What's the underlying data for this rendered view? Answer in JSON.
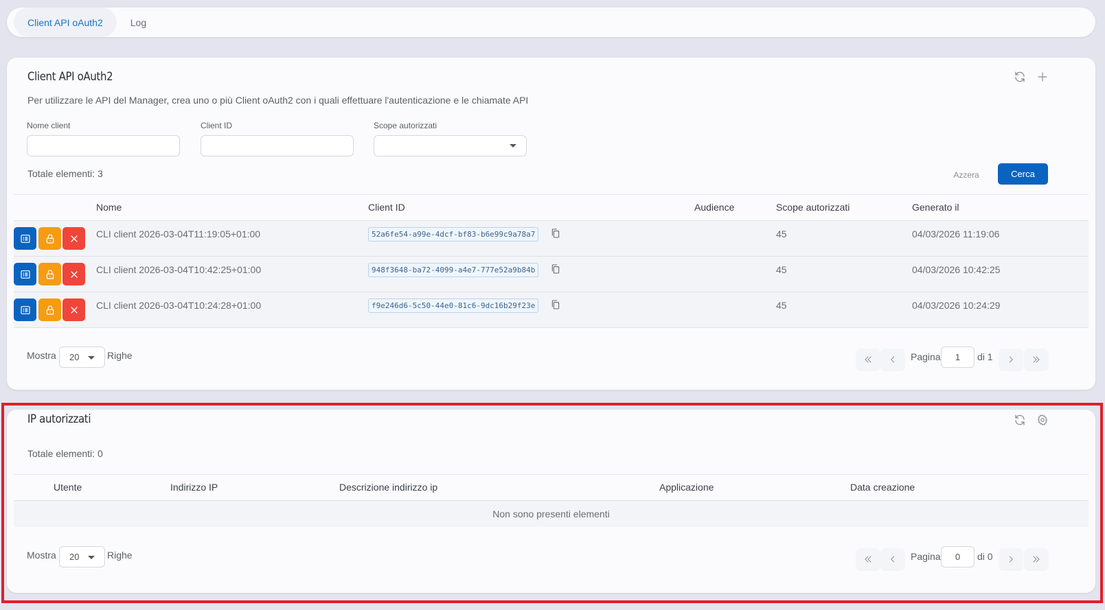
{
  "tabs": [
    {
      "label": "Client API oAuth2",
      "active": true
    },
    {
      "label": "Log",
      "active": false
    }
  ],
  "clients_card": {
    "title": "Client API oAuth2",
    "description": "Per utilizzare le API del Manager, crea uno o più Client oAuth2 con i quali effettuare l'autenticazione e le chiamate API",
    "icons": [
      "refresh-icon",
      "plus-icon"
    ],
    "filters": {
      "name_label": "Nome client",
      "name_value": "",
      "client_id_label": "Client ID",
      "client_id_value": "",
      "scope_label": "Scope autorizzati",
      "scope_value": ""
    },
    "total": "Totale elementi: 3",
    "reset_label": "Azzera",
    "search_label": "Cerca",
    "columns": [
      "Nome",
      "Client ID",
      "Audience",
      "Scope autorizzati",
      "Generato il"
    ],
    "rows": [
      {
        "name": "CLI client 2026-03-04T11:19:05+01:00",
        "client_id": "52a6fe54-a99e-4dcf-bf83-b6e99c9a78a7",
        "audience": "",
        "scope": "45",
        "generated": "04/03/2026 11:19:06"
      },
      {
        "name": "CLI client 2026-03-04T10:42:25+01:00",
        "client_id": "948f3648-ba72-4099-a4e7-777e52a9b84b",
        "audience": "",
        "scope": "45",
        "generated": "04/03/2026 10:42:25"
      },
      {
        "name": "CLI client 2026-03-04T10:24:28+01:00",
        "client_id": "f9e246d6-5c50-44e0-81c6-9dc16b29f23e",
        "audience": "",
        "scope": "45",
        "generated": "04/03/2026 10:24:29"
      }
    ],
    "footer": {
      "show_label": "Mostra",
      "rows_value": "20",
      "rows_label": "Righe",
      "page_label": "Pagina",
      "page_value": "1",
      "of_label": "di 1"
    }
  },
  "ip_card": {
    "title": "IP autorizzati",
    "icons": [
      "refresh-icon",
      "gear-icon"
    ],
    "total": "Totale elementi: 0",
    "columns": [
      "Utente",
      "Indirizzo IP",
      "Descrizione indirizzo ip",
      "Applicazione",
      "Data creazione"
    ],
    "empty_text": "Non sono presenti elementi",
    "footer": {
      "show_label": "Mostra",
      "rows_value": "20",
      "rows_label": "Righe",
      "page_label": "Pagina",
      "page_value": "0",
      "of_label": "di 0"
    }
  },
  "colors": {
    "primary": "#0b63c0",
    "warning": "#f59c11",
    "danger": "#f0453a",
    "highlight": "#e01f2b"
  }
}
